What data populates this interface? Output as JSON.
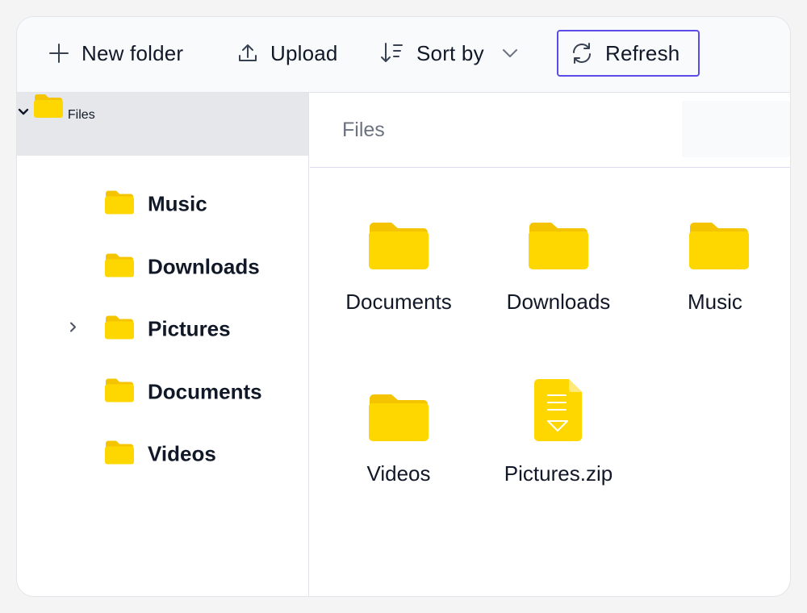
{
  "toolbar": {
    "new_folder_label": "New folder",
    "upload_label": "Upload",
    "sort_label": "Sort by",
    "refresh_label": "Refresh"
  },
  "sidebar": {
    "root": {
      "label": "Files",
      "expanded": true
    },
    "items": [
      {
        "label": "Music",
        "has_children": false
      },
      {
        "label": "Downloads",
        "has_children": false
      },
      {
        "label": "Pictures",
        "has_children": true
      },
      {
        "label": "Documents",
        "has_children": false
      },
      {
        "label": "Videos",
        "has_children": false
      }
    ]
  },
  "breadcrumb": {
    "current": "Files"
  },
  "files": [
    {
      "name": "Documents",
      "type": "folder"
    },
    {
      "name": "Downloads",
      "type": "folder"
    },
    {
      "name": "Music",
      "type": "folder"
    },
    {
      "name": "Videos",
      "type": "folder"
    },
    {
      "name": "Pictures.zip",
      "type": "zip"
    }
  ],
  "colors": {
    "accent": "#5b4ce8",
    "folder": "#ffd700",
    "folder_back": "#f5c400",
    "selected_bg": "#e5e7eb"
  }
}
